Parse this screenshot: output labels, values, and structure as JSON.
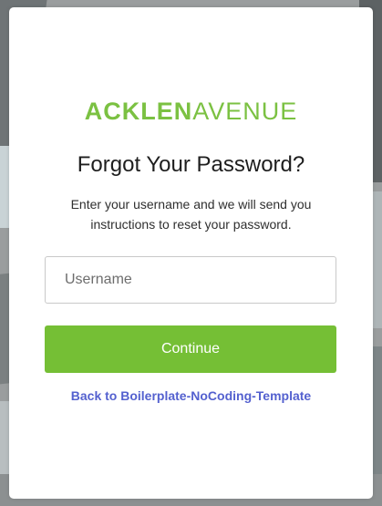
{
  "brand": {
    "logo_strong": "ACKLEN",
    "logo_light": "AVENUE",
    "color": "#7bc142"
  },
  "form": {
    "title": "Forgot Your Password?",
    "instructions": "Enter your username and we will send you instructions to reset your password.",
    "username_placeholder": "Username",
    "username_value": "",
    "continue_label": "Continue",
    "continue_color": "#75bf35",
    "back_link_label": "Back to Boilerplate-NoCoding-Template",
    "link_color": "#5461cf"
  }
}
